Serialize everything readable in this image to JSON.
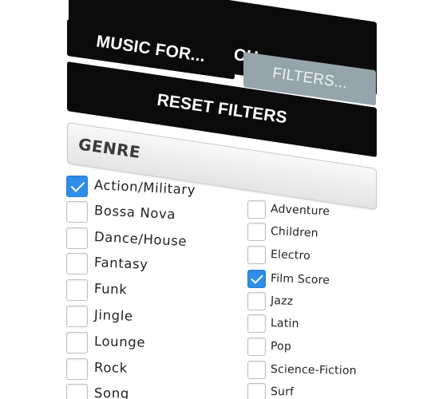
{
  "buttons": {
    "search": "SEARCH",
    "music_for": "MUSIC FOR...",
    "filters": "FILTERS...",
    "reset_filters": "RESET FILTERS"
  },
  "genre": {
    "title": "GENRE",
    "left_column": [
      {
        "label": "Action/Military",
        "checked": true
      },
      {
        "label": "Bossa Nova",
        "checked": false
      },
      {
        "label": "Dance/House",
        "checked": false
      },
      {
        "label": "Fantasy",
        "checked": false
      },
      {
        "label": "Funk",
        "checked": false
      },
      {
        "label": "Jingle",
        "checked": false
      },
      {
        "label": "Lounge",
        "checked": false
      },
      {
        "label": "Rock",
        "checked": false
      },
      {
        "label": "Song",
        "checked": false
      }
    ],
    "right_column": [
      {
        "label": "Adventure",
        "checked": false
      },
      {
        "label": "Children",
        "checked": false
      },
      {
        "label": "Electro",
        "checked": false
      },
      {
        "label": "Film Score",
        "checked": true
      },
      {
        "label": "Jazz",
        "checked": false
      },
      {
        "label": "Latin",
        "checked": false
      },
      {
        "label": "Pop",
        "checked": false
      },
      {
        "label": "Science-Fiction",
        "checked": false
      },
      {
        "label": "Surf",
        "checked": false
      }
    ]
  },
  "colors": {
    "button_dark": "#0b0b0b",
    "button_muted": "#95a5ab",
    "checkbox_checked": "#2f8ee8"
  }
}
